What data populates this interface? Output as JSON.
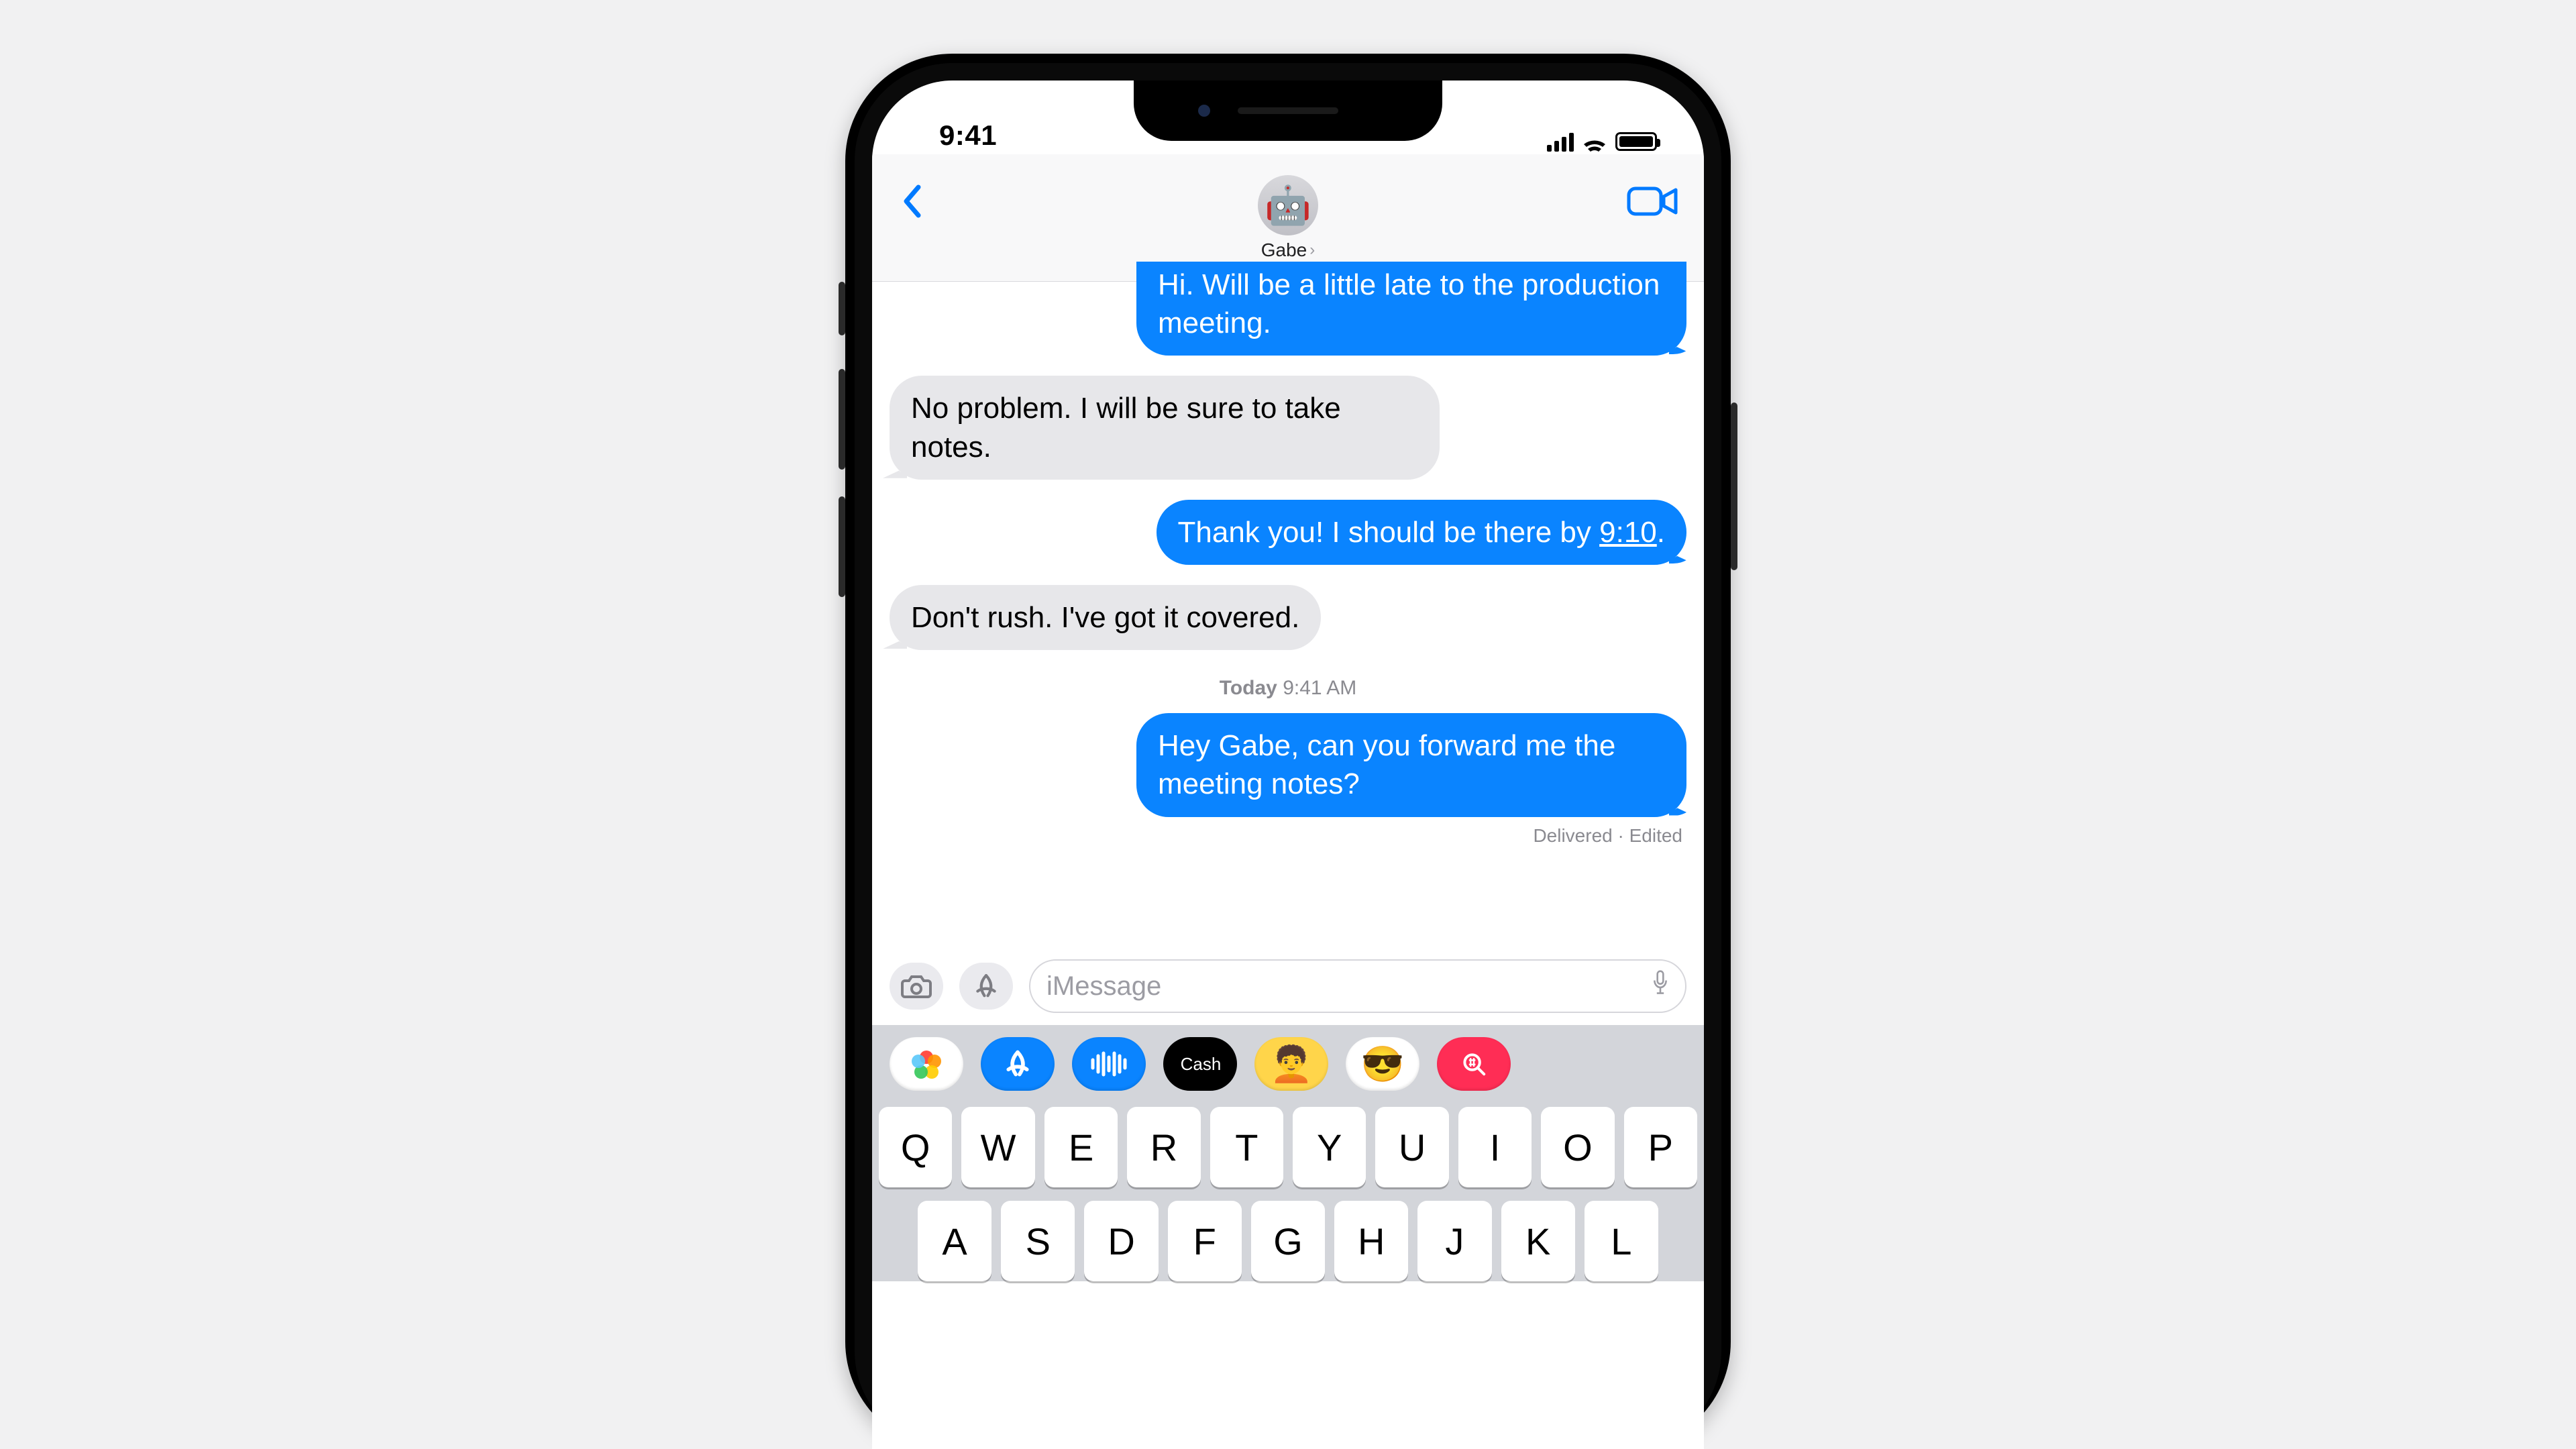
{
  "status": {
    "time": "9:41"
  },
  "header": {
    "contact_name": "Gabe",
    "avatar_emoji": "🤖"
  },
  "messages": {
    "m0": "Hi. Will be a little late to the production meeting.",
    "m1": "No problem. I will be sure to take notes.",
    "m2_pre": "Thank you! I should be there by ",
    "m2_time": "9:10",
    "m2_post": ".",
    "m3": "Don't rush. I've got it covered.",
    "m4": "Hey Gabe, can you forward me the meeting notes?"
  },
  "timestamp": {
    "day": "Today",
    "time": "9:41 AM"
  },
  "delivery_status": "Delivered · Edited",
  "input": {
    "placeholder": "iMessage"
  },
  "apps": {
    "cash_label": "Cash"
  },
  "keyboard": {
    "row1": [
      "Q",
      "W",
      "E",
      "R",
      "T",
      "Y",
      "U",
      "I",
      "O",
      "P"
    ],
    "row2": [
      "A",
      "S",
      "D",
      "F",
      "G",
      "H",
      "J",
      "K",
      "L"
    ]
  }
}
